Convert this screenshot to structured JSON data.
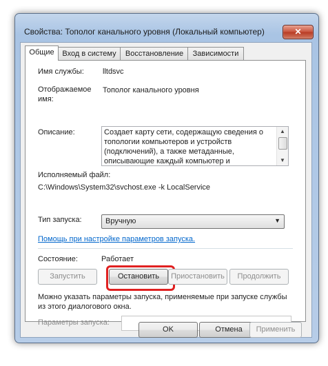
{
  "window": {
    "title": "Свойства: Тополог канального уровня (Локальный компьютер)",
    "close_glyph": "✕"
  },
  "tabs": [
    {
      "label": "Общие",
      "active": true
    },
    {
      "label": "Вход в систему",
      "active": false
    },
    {
      "label": "Восстановление",
      "active": false
    },
    {
      "label": "Зависимости",
      "active": false
    }
  ],
  "general": {
    "service_name_label": "Имя службы:",
    "service_name_value": "lltdsvc",
    "display_name_label": "Отображаемое имя:",
    "display_name_value": "Тополог канального уровня",
    "description_label": "Описание:",
    "description_value": "Создает карту сети, содержащую сведения о топологии компьютеров и устройств (подключений), а также метаданные, описывающие каждый компьютер и",
    "exe_label": "Исполняемый файл:",
    "exe_value": "C:\\Windows\\System32\\svchost.exe -k LocalService",
    "startup_type_label": "Тип запуска:",
    "startup_type_value": "Вручную",
    "help_link": "Помощь при настройке параметров запуска.",
    "status_label": "Состояние:",
    "status_value": "Работает",
    "buttons": {
      "start": "Запустить",
      "stop": "Остановить",
      "pause": "Приостановить",
      "resume": "Продолжить"
    },
    "params_hint": "Можно указать параметры запуска, применяемые при запуске службы из этого диалогового окна.",
    "params_label": "Параметры запуска:",
    "params_value": ""
  },
  "footer": {
    "ok": "OK",
    "cancel": "Отмена",
    "apply": "Применить"
  },
  "colors": {
    "highlight": "#e02020",
    "link": "#0066cc",
    "close_button": "#c8533d"
  }
}
